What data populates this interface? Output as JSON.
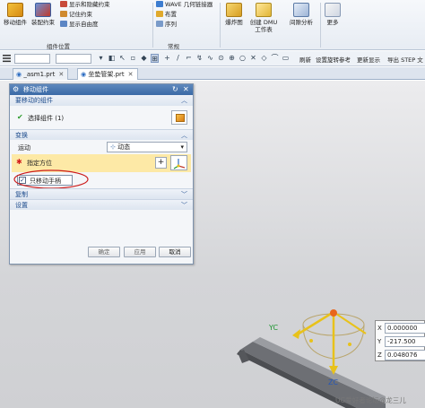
{
  "ribbon": {
    "move_component": "移动组件",
    "assembly_constraints": "装配约束",
    "show_hide_constraints": "显示和隐藏约束",
    "remember_constraints": "记住约束",
    "show_auto_assembly": "显示自由度",
    "component_position_group": "组件位置",
    "wave_geometry_linker": "WAVE 几何链接器",
    "layout": "布置",
    "sequence": "序列",
    "general_group": "常规",
    "explosion_view": "爆炸图",
    "create_dmu": "创建 DMU",
    "workbench": "工作表",
    "interference_analysis": "间隙分析",
    "more": "更多"
  },
  "selection_toolbar": {
    "refresh": "刷新",
    "set_rotation_reference": "设置旋转参考",
    "update_display": "更新显示",
    "export_step": "导出 STEP 文"
  },
  "tabs": [
    {
      "label": "_asm1.prt"
    },
    {
      "label": "坐垫管架.prt"
    }
  ],
  "dialog": {
    "title": "移动组件",
    "section_components": "要移动的组件",
    "select_component": "选择组件 (1)",
    "section_transform": "变换",
    "motion_label": "运动",
    "motion_value": "动态",
    "specify_orientation": "指定方位",
    "only_move_handle": "只移动手柄",
    "section_copy": "复制",
    "section_settings": "设置",
    "ok": "确定",
    "apply": "应用",
    "cancel": "取消"
  },
  "graphics": {
    "axis_x": "X",
    "axis_y": "Y",
    "axis_z": "Z",
    "axis_yc": "YC",
    "axis_zc": "ZC",
    "x_value": "0.000000",
    "y_value": "-217.500",
    "z_value": "0.048076"
  },
  "watermark": "UG爱好者论坛@龙三儿",
  "colors": {
    "title_bar": "#3b6aa6",
    "highlight_row": "#fde9a6",
    "annotation_circle": "#cc1d1d",
    "handle_yellow": "#e8c21a",
    "handle_orange": "#e9651b"
  }
}
